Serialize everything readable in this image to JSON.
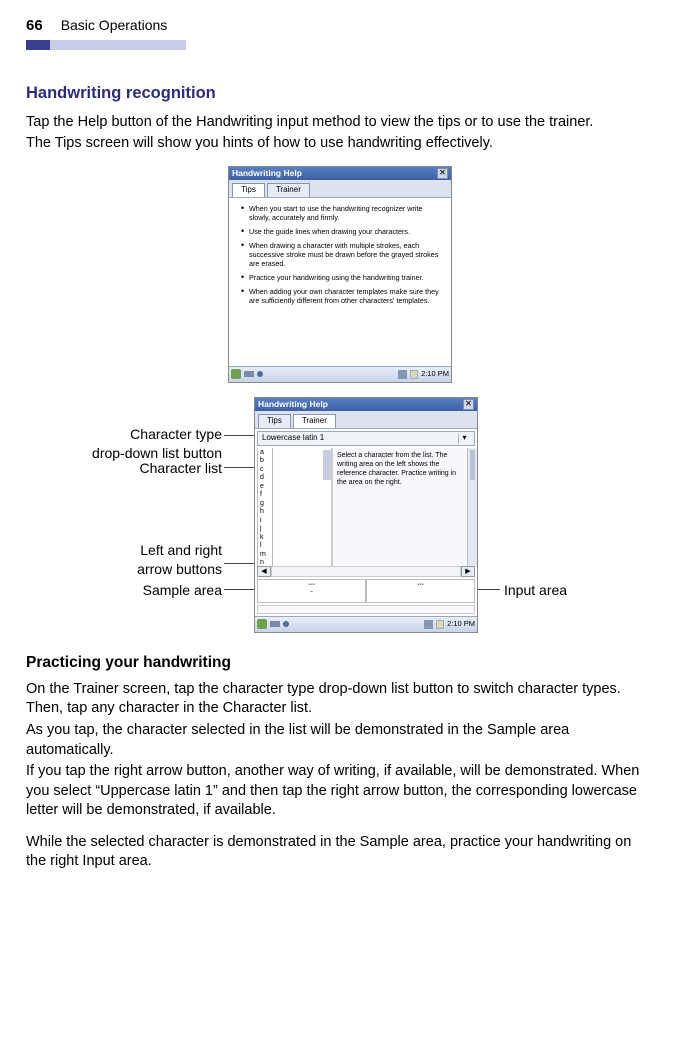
{
  "page": {
    "number": "66",
    "chapter": "Basic Operations"
  },
  "section1": {
    "title": "Handwriting recognition",
    "p1": "Tap the Help button of the Handwriting input method to view the tips or to use the trainer.",
    "p2": "The Tips screen will show you hints of how to use handwriting effectively."
  },
  "fig1": {
    "title": "Handwriting Help",
    "tab_tips": "Tips",
    "tab_trainer": "Trainer",
    "tips": [
      "When you start to use the handwriting recognizer write slowly, accurately and firmly.",
      "Use the guide lines when drawing your characters.",
      "When drawing a character with multiple strokes, each successive stroke must be drawn before the grayed strokes are erased.",
      "Practice your handwriting using the handwriting trainer.",
      "When adding your own character templates make sure they are sufficiently different from other characters' templates."
    ],
    "time": "2:10 PM"
  },
  "fig2": {
    "title": "Handwriting Help",
    "tab_tips": "Tips",
    "tab_trainer": "Trainer",
    "char_type": "Lowercase latin 1",
    "chars": [
      "a",
      "b",
      "c",
      "d",
      "e",
      "f",
      "g",
      "h",
      "i",
      "j",
      "k",
      "l",
      "m",
      "n"
    ],
    "instruction": "Select a character from the list.  The writing area on the left shows the reference character.  Practice writing in the area on the right.",
    "sample_char": "-",
    "time": "2:10 PM"
  },
  "annotations": {
    "char_type": "Character type",
    "dropdown": "drop-down list button",
    "char_list": "Character list",
    "arrows1": "Left and right",
    "arrows2": "arrow buttons",
    "sample": "Sample area",
    "input": "Input area"
  },
  "section2": {
    "title": "Practicing your handwriting",
    "p1": "On the Trainer screen, tap the character type drop-down list button to switch character types. Then, tap any character in the Character list.",
    "p2": "As you tap, the character selected in the list will be demonstrated in the Sample area automatically.",
    "p3": "If you tap the right arrow button, another way of writing, if available, will be demonstrated. When you select “Uppercase latin 1” and then tap the right arrow button, the corresponding lowercase letter will be demonstrated, if available.",
    "p4": "While the selected character is demonstrated in the Sample area, practice your handwriting on the right Input area."
  }
}
